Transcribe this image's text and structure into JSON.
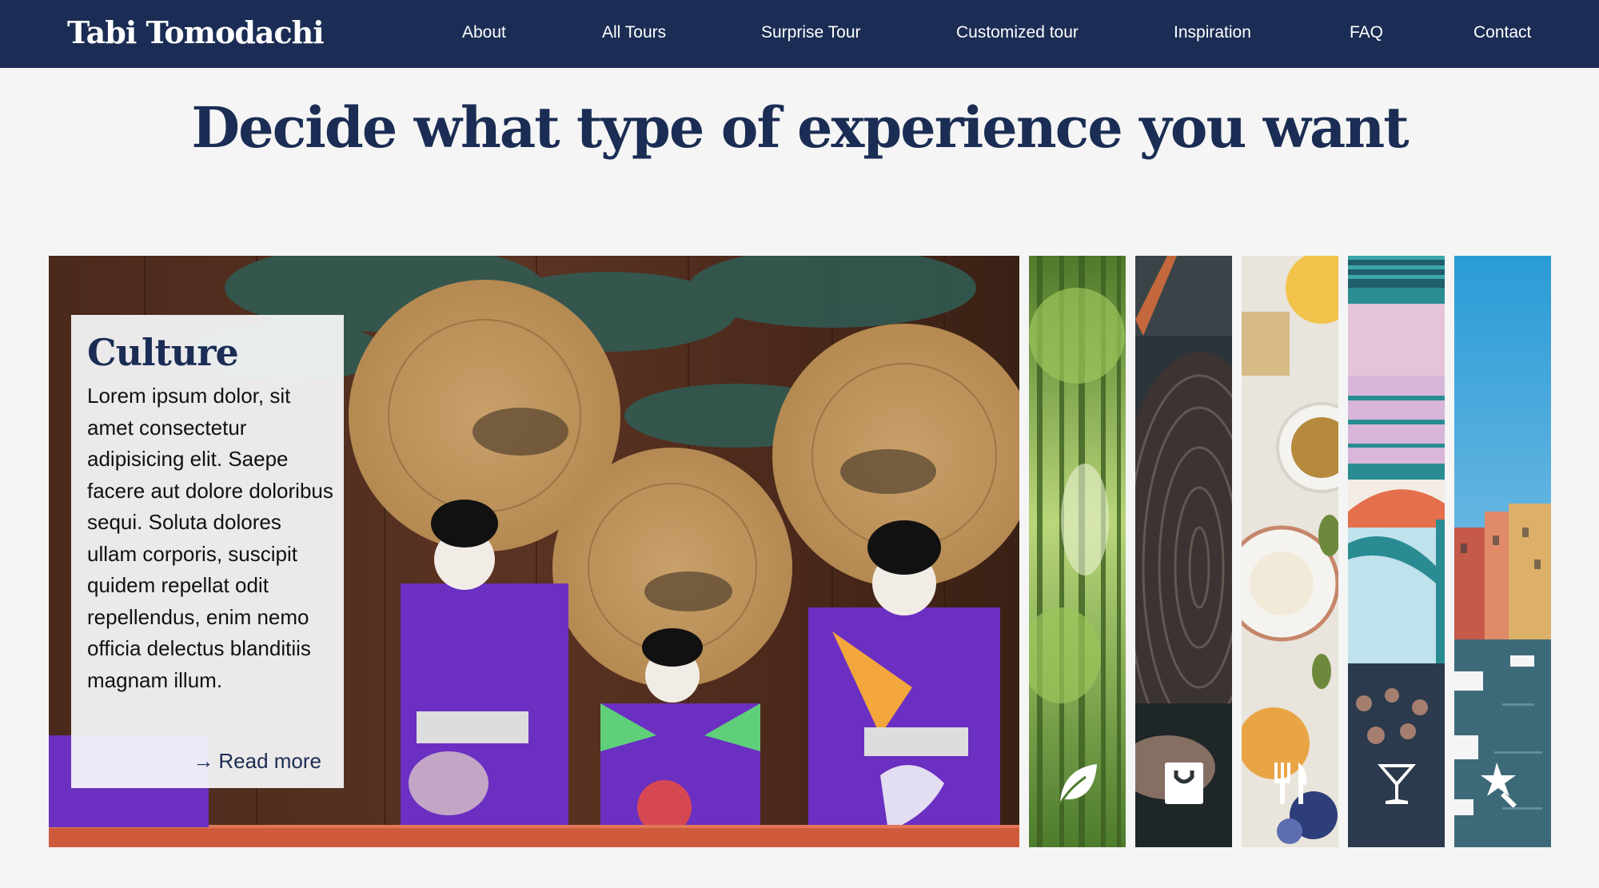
{
  "brand": "Tabi Tomodachi",
  "nav": {
    "about": "About",
    "all_tours": "All Tours",
    "surprise_tour": "Surprise Tour",
    "customized_tour": "Customized tour",
    "inspiration": "Inspiration",
    "faq": "FAQ",
    "contact": "Contact"
  },
  "headline": "Decide what type of experience you want",
  "featured": {
    "title": "Culture",
    "text": "Lorem ipsum dolor, sit amet consectetur adipisicing elit. Saepe facere aut dolore doloribus sequi. Soluta dolores ullam corporis, suscipit quidem repellat odit repellendus, enim nemo officia delectus blanditiis magnam illum.",
    "read_more": "Read more",
    "arrow": "→"
  },
  "strips": [
    {
      "icon": "leaf-icon"
    },
    {
      "icon": "shopping-bag-icon"
    },
    {
      "icon": "utensils-icon"
    },
    {
      "icon": "cocktail-glass-icon"
    },
    {
      "icon": "magic-wand-icon"
    }
  ],
  "colors": {
    "navy": "#1b2d54",
    "background": "#f5f5f5",
    "card": "#f8f8fa"
  }
}
